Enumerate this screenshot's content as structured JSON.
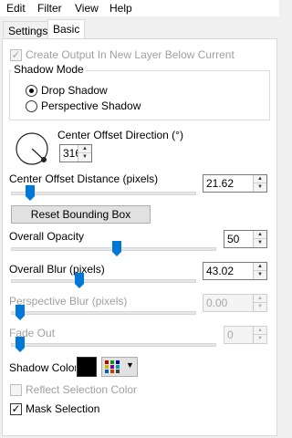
{
  "menu": [
    "Edit",
    "Filter",
    "View",
    "Help"
  ],
  "tabs": [
    "Settings",
    "Basic"
  ],
  "create_output": {
    "label": "Create Output In New Layer Below Current",
    "checked": true,
    "enabled": false
  },
  "shadow_mode": {
    "title": "Shadow Mode",
    "options": [
      "Drop Shadow",
      "Perspective Shadow"
    ],
    "selected": "Drop Shadow"
  },
  "direction": {
    "label": "Center Offset Direction (°)",
    "value": "316"
  },
  "distance": {
    "label": "Center Offset Distance (pixels)",
    "value": "21.62",
    "level": 0.11
  },
  "reset_button": "Reset Bounding Box",
  "opacity": {
    "label": "Overall Opacity",
    "value": "50",
    "level": 0.5
  },
  "blur": {
    "label": "Overall Blur (pixels)",
    "value": "43.02",
    "level": 0.3
  },
  "perspective_blur": {
    "label": "Perspective Blur (pixels)",
    "value": "0.00",
    "level": 0.0,
    "enabled": false
  },
  "fade_out": {
    "label": "Fade Out",
    "value": "0",
    "level": 0.0,
    "enabled": false
  },
  "shadow_color": {
    "label": "Shadow Color",
    "color": "#000000"
  },
  "reflect_selection": {
    "label": "Reflect Selection Color",
    "checked": false,
    "enabled": false
  },
  "mask_selection": {
    "label": "Mask Selection",
    "checked": true
  },
  "colors": {
    "accent": "#0078d7",
    "disabled_text": "#a0a0a0"
  }
}
